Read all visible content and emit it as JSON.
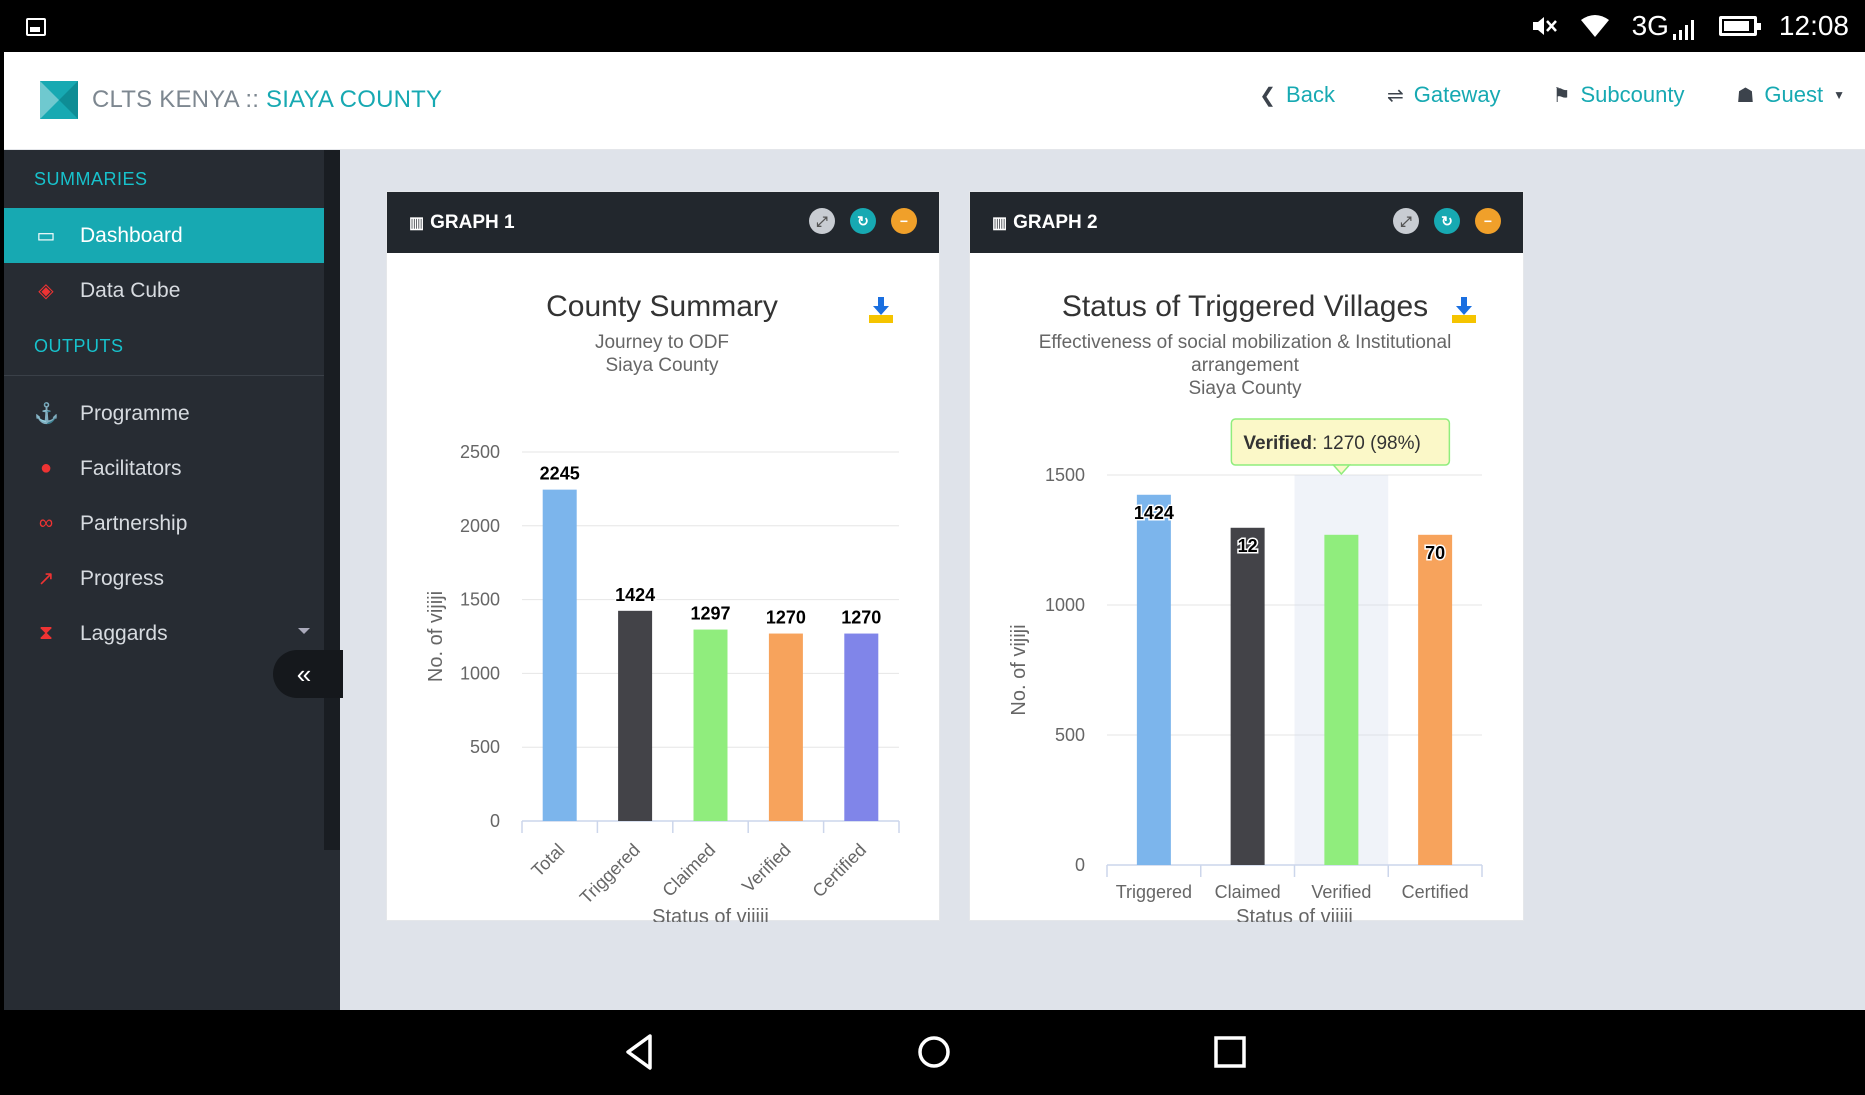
{
  "status_bar": {
    "network": "3G",
    "time": "12:08"
  },
  "brand": {
    "name": "CLTS KENYA",
    "sep": " :: ",
    "county": "SIAYA COUNTY"
  },
  "nav": {
    "back": "Back",
    "gateway": "Gateway",
    "subcounty": "Subcounty",
    "guest": "Guest"
  },
  "sidebar": {
    "summaries_label": "SUMMARIES",
    "outputs_label": "OUTPUTS",
    "items": [
      {
        "label": "Dashboard",
        "icon": "laptop-icon"
      },
      {
        "label": "Data Cube",
        "icon": "cube-icon"
      },
      {
        "label": "Programme",
        "icon": "anchor-icon"
      },
      {
        "label": "Facilitators",
        "icon": "users-icon"
      },
      {
        "label": "Partnership",
        "icon": "handshake-icon"
      },
      {
        "label": "Progress",
        "icon": "line-chart-icon"
      },
      {
        "label": "Laggards",
        "icon": "hourglass-icon"
      }
    ],
    "collapse": "«"
  },
  "panels": {
    "graph1_title": "GRAPH 1",
    "graph2_title": "GRAPH 2"
  },
  "chart_data": [
    {
      "type": "bar",
      "title": "County Summary",
      "subtitle": [
        "Journey to ODF",
        "Siaya County"
      ],
      "xlabel": "Status of vijiji",
      "ylabel": "No. of vijiji",
      "categories": [
        "Total",
        "Triggered",
        "Claimed",
        "Verified",
        "Certified"
      ],
      "values": [
        2245,
        1424,
        1297,
        1270,
        1270
      ],
      "colors": [
        "#7cb5ec",
        "#434348",
        "#90ed7d",
        "#f7a35c",
        "#8085e9"
      ],
      "ylim": [
        0,
        2500
      ],
      "yticks": [
        0,
        500,
        1000,
        1500,
        2000,
        2500
      ],
      "data_labels": true,
      "grid": true,
      "x_tick_rotation": "rotated"
    },
    {
      "type": "bar",
      "title": "Status of Triggered Villages",
      "subtitle": [
        "Effectiveness of social mobilization & Institutional",
        "arrangement",
        "Siaya County"
      ],
      "xlabel": "Status of vijiji",
      "ylabel": "No. of vijiji",
      "categories": [
        "Triggered",
        "Claimed",
        "Verified",
        "Certified"
      ],
      "values": [
        1424,
        1297,
        1270,
        1270
      ],
      "data_labels_shown": [
        "1424",
        "12",
        "",
        "70"
      ],
      "colors": [
        "#7cb5ec",
        "#434348",
        "#90ed7d",
        "#f7a35c"
      ],
      "ylim": [
        0,
        1500
      ],
      "yticks": [
        0,
        500,
        1000,
        1500
      ],
      "grid": true,
      "highlighted_category": "Verified",
      "tooltip": {
        "label": "Verified",
        "text": ": 1270 (98%)"
      }
    }
  ]
}
